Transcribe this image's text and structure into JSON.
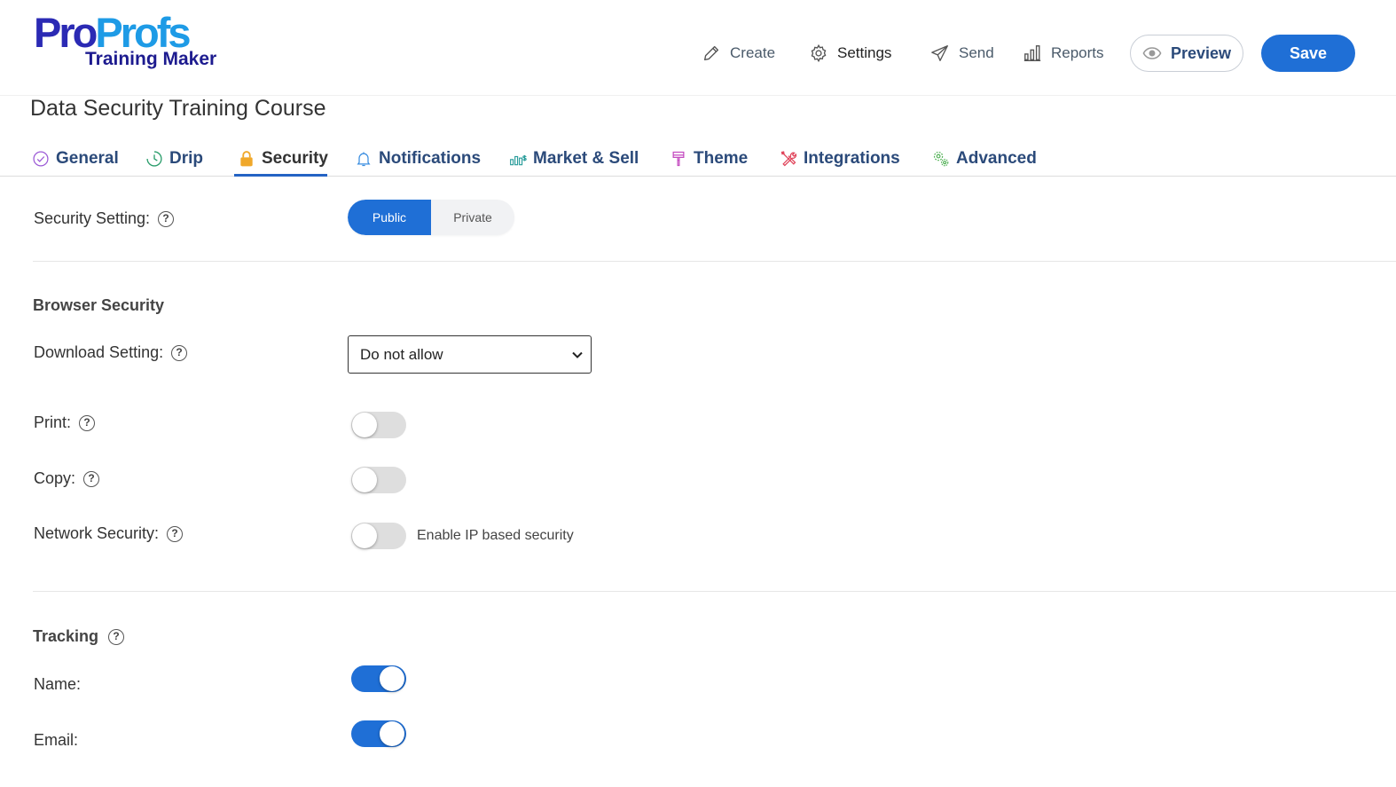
{
  "brand": {
    "name_part1": "Pro",
    "name_part2": "Profs",
    "product": "Training Maker",
    "colors": {
      "primary": "#2b2ab4",
      "secondary": "#1e9be6",
      "accent": "#1f6fd6"
    }
  },
  "topnav": {
    "create": {
      "label": "Create",
      "icon": "pencil-icon"
    },
    "settings": {
      "label": "Settings",
      "icon": "gear-icon"
    },
    "send": {
      "label": "Send",
      "icon": "paper-plane-icon"
    },
    "reports": {
      "label": "Reports",
      "icon": "bar-chart-icon"
    },
    "preview": {
      "label": "Preview",
      "icon": "eye-icon"
    },
    "save": {
      "label": "Save"
    }
  },
  "course": {
    "title": "Data Security Training Course"
  },
  "tabs": [
    {
      "label": "General",
      "icon": "check-circle-icon",
      "active": false
    },
    {
      "label": "Drip",
      "icon": "clock-icon",
      "active": false
    },
    {
      "label": "Security",
      "icon": "lock-icon",
      "active": true
    },
    {
      "label": "Notifications",
      "icon": "bell-icon",
      "active": false
    },
    {
      "label": "Market & Sell",
      "icon": "chart-dollar-icon",
      "active": false
    },
    {
      "label": "Theme",
      "icon": "paint-brush-icon",
      "active": false
    },
    {
      "label": "Integrations",
      "icon": "tools-icon",
      "active": false
    },
    {
      "label": "Advanced",
      "icon": "gears-icon",
      "active": false
    }
  ],
  "security_setting": {
    "label": "Security Setting:",
    "options": [
      "Public",
      "Private"
    ],
    "selected": "Public"
  },
  "browser_security": {
    "title": "Browser Security",
    "download": {
      "label": "Download Setting:",
      "value": "Do not allow"
    },
    "print": {
      "label": "Print:",
      "enabled": false
    },
    "copy": {
      "label": "Copy:",
      "enabled": false
    },
    "network": {
      "label": "Network Security:",
      "enabled": false,
      "text": "Enable IP based security"
    }
  },
  "tracking": {
    "title": "Tracking",
    "name": {
      "label": "Name:",
      "enabled": true
    },
    "email": {
      "label": "Email:",
      "enabled": true
    }
  },
  "help_glyph": "?"
}
